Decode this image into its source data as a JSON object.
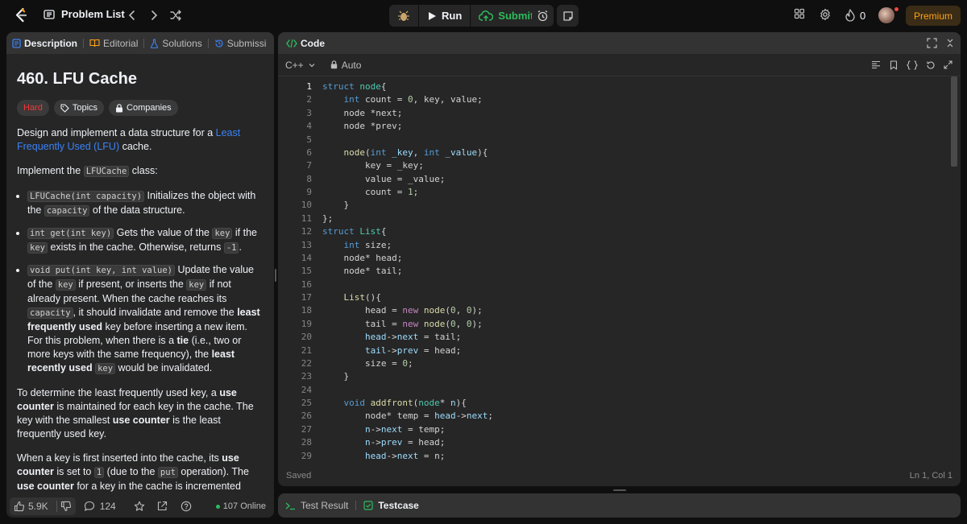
{
  "topbar": {
    "problem_list": "Problem List",
    "run": "Run",
    "submit": "Submit",
    "streak": "0",
    "premium": "Premium"
  },
  "left": {
    "tabs": [
      "Description",
      "Editorial",
      "Solutions",
      "Submissi"
    ],
    "title": "460. LFU Cache",
    "chips": {
      "difficulty": "Hard",
      "topics": "Topics",
      "companies": "Companies"
    },
    "footer": {
      "likes": "5.9K",
      "comments": "124",
      "online": "107 Online"
    }
  },
  "editor": {
    "title": "Code",
    "language": "C++",
    "mode": "Auto",
    "status": "Saved",
    "cursor": "Ln 1, Col 1",
    "current_line": 1
  },
  "bottom": {
    "tabs": [
      "Test Result",
      "Testcase"
    ]
  },
  "colors": {
    "accent": "#ffa116",
    "submit_green": "#2cbb5d",
    "link_blue": "#3b82f6",
    "hard_red": "#f63737"
  }
}
